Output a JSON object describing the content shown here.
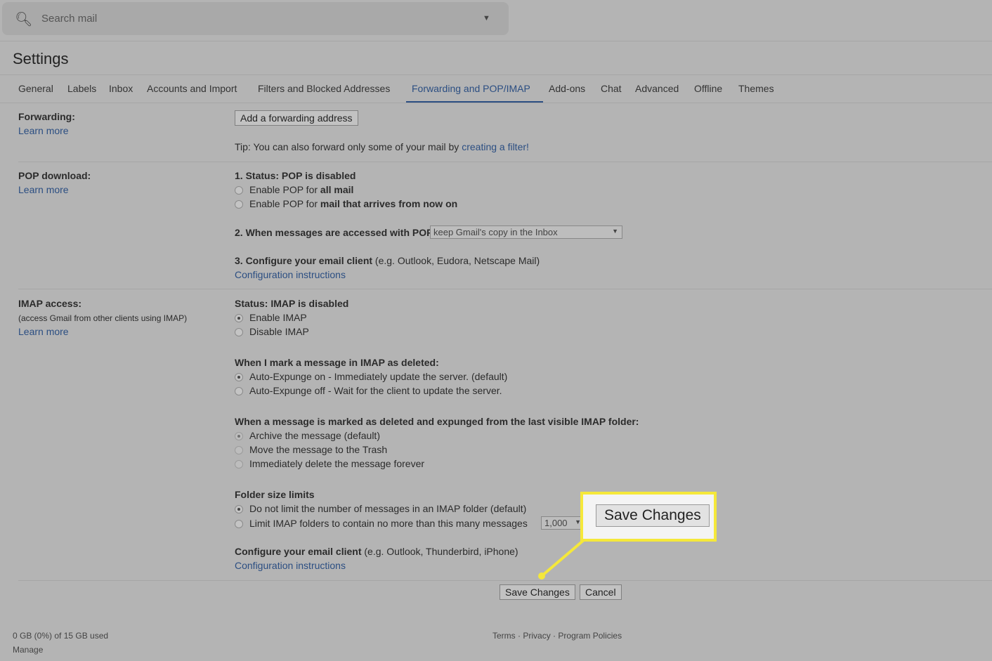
{
  "search": {
    "placeholder": "Search mail",
    "icon": "search-icon"
  },
  "title": "Settings",
  "tabs": [
    {
      "label": "General"
    },
    {
      "label": "Labels"
    },
    {
      "label": "Inbox"
    },
    {
      "label": "Accounts and Import"
    },
    {
      "label": "Filters and Blocked Addresses"
    },
    {
      "label": "Forwarding and POP/IMAP",
      "active": true
    },
    {
      "label": "Add-ons"
    },
    {
      "label": "Chat"
    },
    {
      "label": "Advanced"
    },
    {
      "label": "Offline"
    },
    {
      "label": "Themes"
    }
  ],
  "forwarding": {
    "label": "Forwarding:",
    "learn": "Learn more",
    "button": "Add a forwarding address",
    "tip": "Tip: You can also forward only some of your mail by ",
    "tip_link": "creating a filter!"
  },
  "pop": {
    "label": "POP download:",
    "learn": "Learn more",
    "status": "1. Status: POP is disabled",
    "opt1a": "Enable POP for ",
    "opt1b": "all mail",
    "opt2a": "Enable POP for ",
    "opt2b": "mail that arrives from now on",
    "when": "2. When messages are accessed with POP",
    "when_value": "keep Gmail's copy in the Inbox",
    "config": "3. Configure your email client",
    "config_hint": " (e.g. Outlook, Eudora, Netscape Mail)",
    "config_link": "Configuration instructions"
  },
  "imap": {
    "label": "IMAP access:",
    "sub": "(access Gmail from other clients using IMAP)",
    "learn": "Learn more",
    "status": "Status: IMAP is disabled",
    "enable": "Enable IMAP",
    "disable": "Disable IMAP",
    "deleted_title": "When I mark a message in IMAP as deleted:",
    "exp_on": "Auto-Expunge on - Immediately update the server. (default)",
    "exp_off": "Auto-Expunge off - Wait for the client to update the server.",
    "expunged_title": "When a message is marked as deleted and expunged from the last visible IMAP folder:",
    "archive": "Archive the message (default)",
    "trash": "Move the message to the Trash",
    "delete": "Immediately delete the message forever",
    "folder_title": "Folder size limits",
    "nolimit": "Do not limit the number of messages in an IMAP folder (default)",
    "limit": "Limit IMAP folders to contain no more than this many messages",
    "limit_value": "1,000",
    "config": "Configure your email client",
    "config_hint": " (e.g. Outlook, Thunderbird, iPhone)",
    "config_link": "Configuration instructions"
  },
  "actions": {
    "save": "Save Changes",
    "cancel": "Cancel"
  },
  "callout": {
    "label": "Save Changes",
    "color": "#f5e83a"
  },
  "footer": {
    "usage": "0 GB (0%) of 15 GB used",
    "manage": "Manage",
    "terms": "Terms",
    "privacy": "Privacy",
    "policies": "Program Policies",
    "dot": "·"
  }
}
